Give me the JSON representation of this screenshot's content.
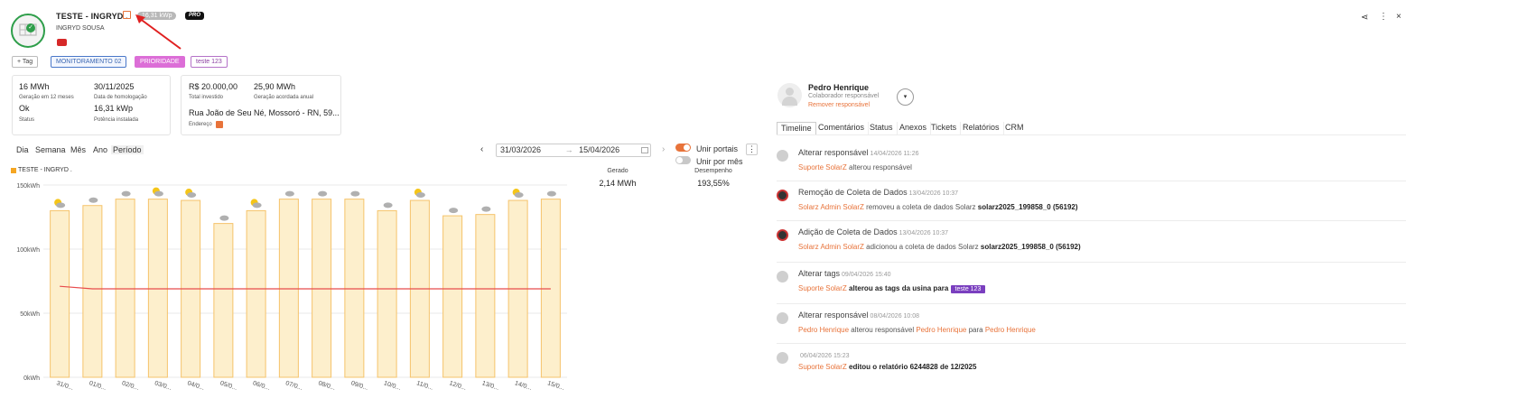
{
  "header": {
    "plant_name": "TESTE - INGRYD .",
    "power_badge": "16,31 kWp",
    "pro_badge": "PRO",
    "owner": "INGRYD SOUSA"
  },
  "tags": {
    "add_label": "Tag",
    "items": [
      "MONITORAMENTO 02",
      "PRIORIDADE",
      "teste 123"
    ]
  },
  "summary_cards": {
    "left": [
      {
        "value": "16 MWh",
        "label": "Geração em 12 meses"
      },
      {
        "value": "30/11/2025",
        "label": "Data de homologação"
      },
      {
        "value": "Ok",
        "label": "Status"
      },
      {
        "value": "16,31 kWp",
        "label": "Potência instalada"
      }
    ],
    "right": [
      {
        "value": "R$ 20.000,00",
        "label": "Total investido"
      },
      {
        "value": "25,90 MWh",
        "label": "Geração acordada anual"
      }
    ],
    "address": {
      "value": "Rua João de Seu Né, Mossoró - RN, 59...",
      "label": "Endereço"
    }
  },
  "period_tabs": [
    "Dia",
    "Semana",
    "Mês",
    "Ano",
    "Período"
  ],
  "selected_period": "Período",
  "date_range": {
    "start": "31/03/2026",
    "end": "15/04/2026",
    "arrow": "→"
  },
  "toggles": [
    {
      "label": "Unir portais",
      "on": true
    },
    {
      "label": "Unir por mês",
      "on": false
    }
  ],
  "stats": [
    {
      "header": "Gerado",
      "value": "2,14 MWh"
    },
    {
      "header": "Desempenho",
      "value": "193,55%"
    }
  ],
  "chart_data": {
    "type": "bar",
    "legend": [
      "TESTE - INGRYD ."
    ],
    "categories": [
      "31/03",
      "01/04",
      "02/04",
      "03/04",
      "04/04",
      "05/04",
      "06/04",
      "07/04",
      "08/04",
      "09/04",
      "10/04",
      "11/04",
      "12/04",
      "13/04",
      "14/04",
      "15/04"
    ],
    "category_labels": [
      "31/0...",
      "01/0...",
      "02/0...",
      "03/0...",
      "04/0...",
      "05/0...",
      "06/0...",
      "07/0...",
      "08/0...",
      "09/0...",
      "10/0...",
      "11/0...",
      "12/0...",
      "13/0...",
      "14/0...",
      "15/0..."
    ],
    "series": [
      {
        "name": "TESTE - INGRYD .",
        "type": "bar",
        "color": "#fbe9bf",
        "values": [
          130,
          134,
          139,
          139,
          138,
          120,
          130,
          139,
          139,
          139,
          130,
          138,
          126,
          127,
          138,
          139
        ]
      },
      {
        "type": "line",
        "color": "#e84c4c",
        "values": [
          71,
          69,
          69,
          69,
          69,
          69,
          69,
          69,
          69,
          69,
          69,
          69,
          69,
          69,
          69,
          69
        ]
      }
    ],
    "weather_icons": [
      "partly-cloudy",
      "cloudy",
      "cloudy",
      "partly-cloudy",
      "partly-cloudy",
      "cloudy",
      "partly-cloudy",
      "cloudy",
      "cloudy",
      "cloudy",
      "cloudy",
      "partly-cloudy",
      "cloudy",
      "cloudy",
      "partly-cloudy",
      "cloudy"
    ],
    "yticks": [
      "150kWh",
      "100kWh",
      "50kWh",
      "0kWh"
    ],
    "ylim": [
      0,
      150
    ],
    "grid": true
  },
  "responsible": {
    "name": "Pedro Henrique",
    "role": "Colaborador responsável",
    "remove_label": "Remover responsável"
  },
  "panel_tabs": [
    "Timeline",
    "Comentários",
    "Status",
    "Anexos",
    "Tickets",
    "Relatórios",
    "CRM"
  ],
  "selected_panel_tab": "Timeline",
  "timeline": [
    {
      "title": "Alterar responsável",
      "date": "14/04/2026 11:26",
      "parts": [
        {
          "t": "Suporte SolarZ",
          "s": "orange"
        },
        {
          "t": " alterou responsável",
          "s": "normal"
        }
      ]
    },
    {
      "title": "Remoção de Coleta de Dados",
      "date": "13/04/2026 10:37",
      "parts": [
        {
          "t": "Solarz Admin SolarZ",
          "s": "orange"
        },
        {
          "t": " removeu a coleta de dados Solarz ",
          "s": "normal"
        },
        {
          "t": "solarz2025_199858_0 (56192)",
          "s": "bold"
        }
      ]
    },
    {
      "title": "Adição de Coleta de Dados",
      "date": "13/04/2026 10:37",
      "parts": [
        {
          "t": "Solarz Admin SolarZ",
          "s": "orange"
        },
        {
          "t": " adicionou a coleta de dados Solarz ",
          "s": "normal"
        },
        {
          "t": "solarz2025_199858_0 (56192)",
          "s": "bold"
        }
      ]
    },
    {
      "title": "Alterar tags",
      "date": "09/04/2026 15:40",
      "parts": [
        {
          "t": "Suporte SolarZ",
          "s": "orange"
        },
        {
          "t": " alterou as tags da usina para ",
          "s": "bold"
        },
        {
          "t": "teste 123",
          "s": "tag"
        }
      ]
    },
    {
      "title": "Alterar responsável",
      "date": "08/04/2026 10:08",
      "parts": [
        {
          "t": "Pedro Henrique",
          "s": "orange"
        },
        {
          "t": " alterou responsável ",
          "s": "normal"
        },
        {
          "t": "Pedro Henrique",
          "s": "orange"
        },
        {
          "t": " para ",
          "s": "normal"
        },
        {
          "t": "Pedro Henrique",
          "s": "orange"
        }
      ]
    },
    {
      "title": "",
      "date": "06/04/2026 15:23",
      "parts": [
        {
          "t": "Suporte SolarZ",
          "s": "orange"
        },
        {
          "t": " editou o relatório 6244828 de 12/2025",
          "s": "bold"
        }
      ]
    }
  ]
}
